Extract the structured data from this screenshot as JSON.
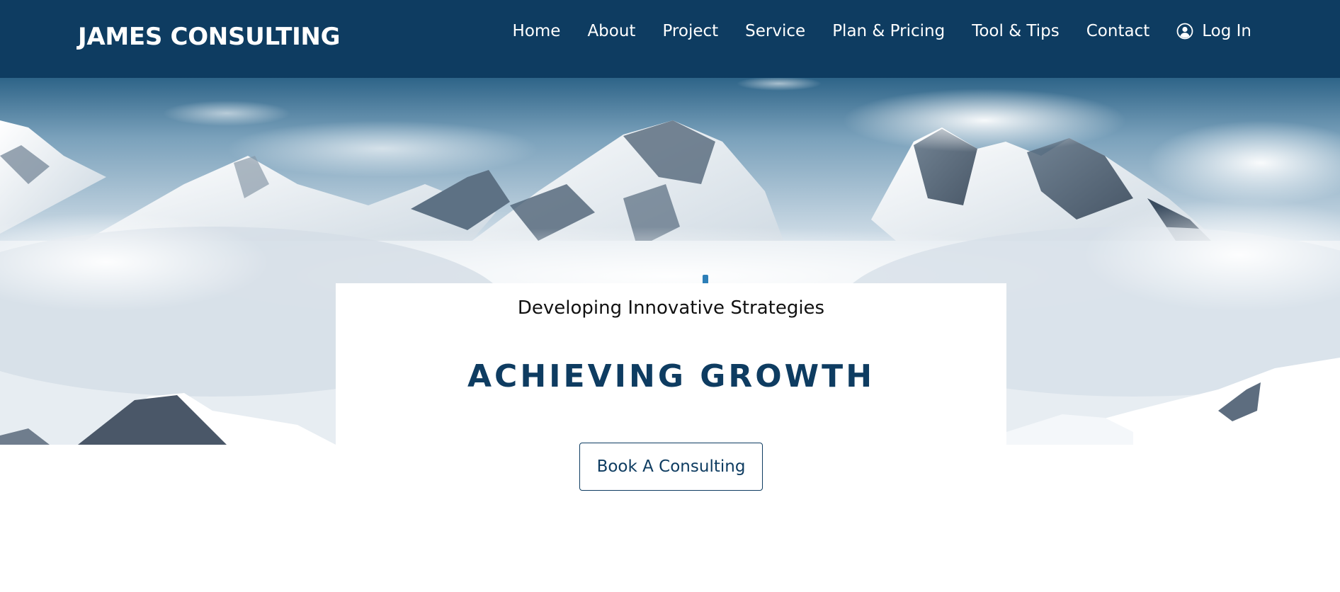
{
  "header": {
    "brand": "JAMES CONSULTING",
    "nav": [
      {
        "label": "Home"
      },
      {
        "label": "About"
      },
      {
        "label": "Project"
      },
      {
        "label": "Service"
      },
      {
        "label": "Plan & Pricing"
      },
      {
        "label": "Tool & Tips"
      },
      {
        "label": "Contact"
      }
    ],
    "login": {
      "label": "Log In",
      "icon": "user-circle-icon"
    }
  },
  "hero": {
    "image": "snowy-mountains-above-clouds",
    "subtitle": "Developing Innovative Strategies",
    "headline": "ACHIEVING GROWTH",
    "cta_label": "Book A Consulting"
  },
  "colors": {
    "header_bg": "#0e3c61",
    "accent": "#0e3c61",
    "text": "#111111",
    "background": "#ffffff"
  }
}
